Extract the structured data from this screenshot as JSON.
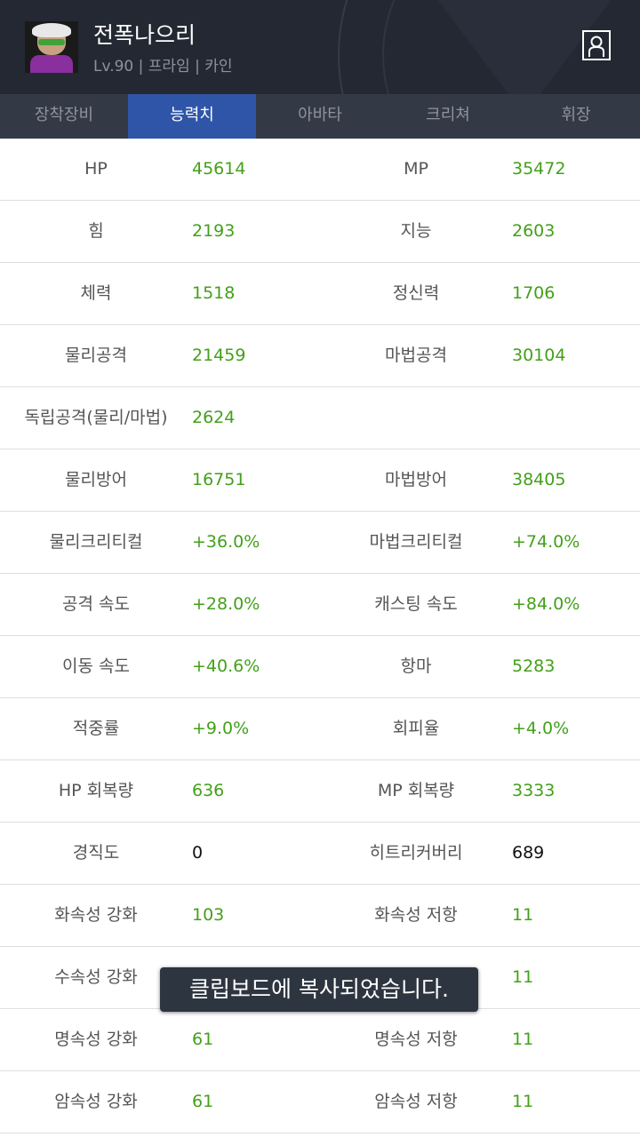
{
  "header": {
    "name": "전폭나으리",
    "level_info": "Lv.90 | 프라임 | 카인"
  },
  "tabs": [
    {
      "label": "장착장비"
    },
    {
      "label": "능력치"
    },
    {
      "label": "아바타"
    },
    {
      "label": "크리쳐"
    },
    {
      "label": "휘장"
    }
  ],
  "stats": [
    {
      "l1": "HP",
      "v1": "45614",
      "l2": "MP",
      "v2": "35472"
    },
    {
      "l1": "힘",
      "v1": "2193",
      "l2": "지능",
      "v2": "2603"
    },
    {
      "l1": "체력",
      "v1": "1518",
      "l2": "정신력",
      "v2": "1706"
    },
    {
      "l1": "물리공격",
      "v1": "21459",
      "l2": "마법공격",
      "v2": "30104"
    },
    {
      "l1": "독립공격(물리/마법)",
      "v1": "2624",
      "l2": "",
      "v2": ""
    },
    {
      "l1": "물리방어",
      "v1": "16751",
      "l2": "마법방어",
      "v2": "38405"
    },
    {
      "l1": "물리크리티컬",
      "v1": "+36.0%",
      "l2": "마법크리티컬",
      "v2": "+74.0%"
    },
    {
      "l1": "공격 속도",
      "v1": "+28.0%",
      "l2": "캐스팅 속도",
      "v2": "+84.0%"
    },
    {
      "l1": "이동 속도",
      "v1": "+40.6%",
      "l2": "항마",
      "v2": "5283"
    },
    {
      "l1": "적중률",
      "v1": "+9.0%",
      "l2": "회피율",
      "v2": "+4.0%"
    },
    {
      "l1": "HP 회복량",
      "v1": "636",
      "l2": "MP 회복량",
      "v2": "3333"
    },
    {
      "l1": "경직도",
      "v1": "0",
      "l2": "히트리커버리",
      "v2": "689"
    },
    {
      "l1": "화속성 강화",
      "v1": "103",
      "l2": "화속성 저항",
      "v2": "11"
    },
    {
      "l1": "수속성 강화",
      "v1": "",
      "l2": "",
      "v2": "11"
    },
    {
      "l1": "명속성 강화",
      "v1": "61",
      "l2": "명속성 저항",
      "v2": "11"
    },
    {
      "l1": "암속성 강화",
      "v1": "61",
      "l2": "암속성 저항",
      "v2": "11"
    }
  ],
  "toast": "클립보드에 복사되었습니다.",
  "colors": {
    "value_green": "#43a01a",
    "tab_active": "#2f55a8",
    "header_bg": "#232833"
  }
}
